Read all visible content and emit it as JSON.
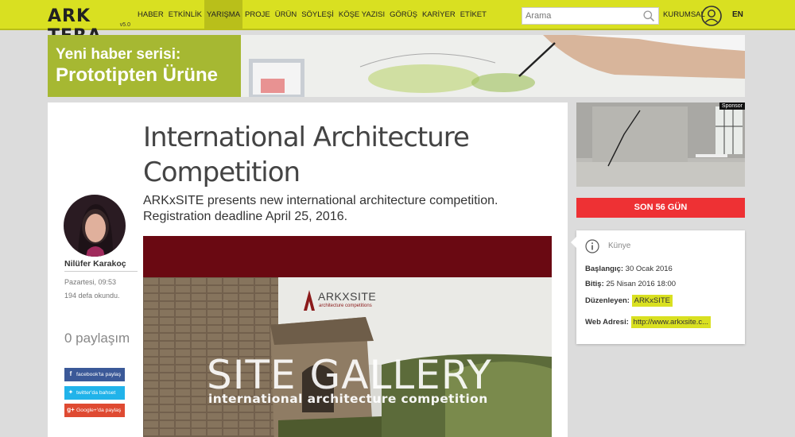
{
  "nav": {
    "logo": "ARK TERA",
    "version": "v5.0",
    "menu": [
      "HABER",
      "ETKİNLİK",
      "YARIŞMA",
      "PROJE",
      "ÜRÜN",
      "SÖYLEŞİ",
      "KÖŞE YAZISI",
      "GÖRÜŞ",
      "KARİYER",
      "ETİKET"
    ],
    "active_index": 2,
    "search_placeholder": "Arama",
    "corporate": "KURUMSAL",
    "lang": "EN"
  },
  "banner": {
    "line1": "Yeni haber serisi:",
    "line2": "Prototipten Ürüne"
  },
  "article": {
    "title": "International Architecture Competition",
    "subtitle": "ARKxSITE presents new international architecture competition. Registration deadline April 25, 2016.",
    "author": "Nilüfer Karakoç",
    "date": "Pazartesi, 09:53",
    "reads": "194  defa okundu.",
    "shares": "0 paylaşım",
    "share_facebook": "facebook'ta paylaş",
    "share_twitter": "twitter'da bahset",
    "share_google": "Google+'da paylaş",
    "hero_brand": "ARKXSITE",
    "hero_brand_sub": "architecture competitions",
    "hero_title": "SITE GALLERY",
    "hero_subtitle": "international architecture competition"
  },
  "sidebar": {
    "sponsor": "Sponsor",
    "countdown": "SON 56 GÜN",
    "kunye_title": "Künye",
    "start_label": "Başlangıç:",
    "start_value": " 30 Ocak 2016",
    "end_label": "Bitiş:",
    "end_value": " 25 Nisan 2016 18:00",
    "organizer_label": "Düzenleyen:",
    "organizer_value": "ARKxSITE",
    "web_label": "Web Adresi:",
    "web_value": "http://www.arkxsite.c..."
  },
  "colors": {
    "accent": "#d9e021",
    "countdown": "#ee3134",
    "hero_band": "#6a0912"
  }
}
